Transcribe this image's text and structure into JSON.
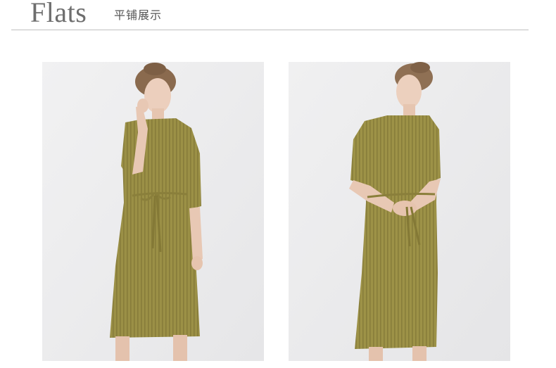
{
  "header": {
    "title": "Flats",
    "subtitle": "平铺展示"
  },
  "photos": [
    {
      "subject": "model-wearing-olive-pleated-dress-hand-at-chin"
    },
    {
      "subject": "model-wearing-olive-pleated-dress-hands-at-waist"
    }
  ],
  "colors": {
    "background": "#ffffff",
    "photo_backdrop": "#ededee",
    "dress": "#9b9046",
    "dress_shadow": "#8a7f3b",
    "skin": "#e8c8b4",
    "hair": "#8a6a4e",
    "title": "#6e6e6e",
    "divider": "#bfbfbf"
  }
}
